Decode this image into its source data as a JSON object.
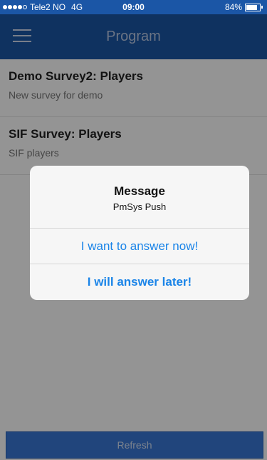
{
  "status_bar": {
    "carrier": "Tele2 NO",
    "network": "4G",
    "time": "09:00",
    "battery": "84%",
    "battery_level": 0.84
  },
  "nav": {
    "title": "Program",
    "menu_icon": "hamburger-menu-icon"
  },
  "list": {
    "items": [
      {
        "title": "Demo Survey2: Players",
        "subtitle": "New survey for demo"
      },
      {
        "title": "SIF Survey: Players",
        "subtitle": "SIF players"
      }
    ]
  },
  "footer": {
    "refresh_label": "Refresh"
  },
  "dialog": {
    "title": "Message",
    "message": "PmSys Push",
    "answer_now_label": "I want to answer now!",
    "answer_later_label": "I will answer later!"
  },
  "colors": {
    "primary": "#1b56a6",
    "button_blue": "#3a78d6",
    "dialog_link": "#1a84e8"
  }
}
